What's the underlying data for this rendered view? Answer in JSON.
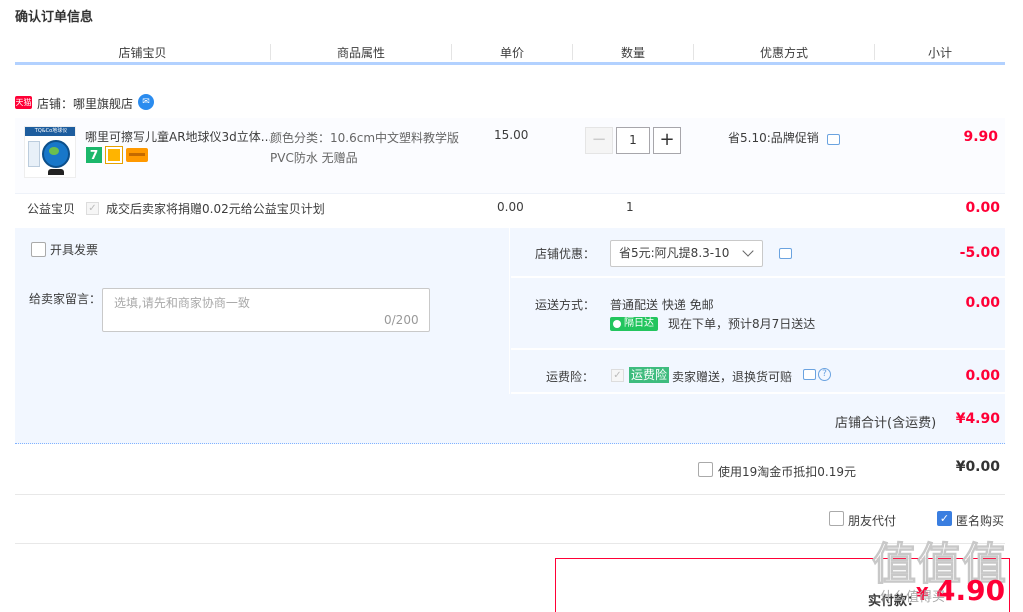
{
  "page_title": "确认订单信息",
  "headers": [
    "店铺宝贝",
    "商品属性",
    "单价",
    "数量",
    "优惠方式",
    "小计"
  ],
  "shop": {
    "logo": "天猫",
    "name": "店铺：哪里旗舰店",
    "ww_icon": "chat-bubble-icon"
  },
  "item": {
    "thumb_band": "TQ&Co地球仪",
    "title": "哪里可擦写儿童AR地球仪3d立体...",
    "attr": "颜色分类：10.6cm中文塑料教学版 PVC防水 无赠品",
    "unit_price": "15.00",
    "qty_minus": "−",
    "qty": "1",
    "qty_plus": "+",
    "promo": "省5.10:品牌促销",
    "subtotal": "9.90",
    "badge_7": "7"
  },
  "charity": {
    "label": "公益宝贝",
    "check": "✓",
    "text": "成交后卖家将捐赠0.02元给公益宝贝计划",
    "price": "0.00",
    "qty": "1",
    "subtotal": "0.00"
  },
  "invoice": {
    "label": "开具发票"
  },
  "message": {
    "label": "给卖家留言：",
    "placeholder": "选填,请先和商家协商一致",
    "count": "0/200"
  },
  "shop_discount": {
    "label": "店铺优惠：",
    "selected": "省5元:阿凡提8.3-10",
    "amount": "-5.00"
  },
  "delivery": {
    "label": "运送方式：",
    "method": "普通配送 快递 免邮",
    "tag": "隔日达",
    "eta": "现在下单，预计8月7日送达",
    "amount": "0.00"
  },
  "insurance": {
    "label": "运费险：",
    "check": "✓",
    "tag": "运费险",
    "text": "卖家赠送，退换货可赔",
    "help": "?",
    "amount": "0.00"
  },
  "shop_total": {
    "label": "店铺合计(含运费)",
    "value": "¥4.90"
  },
  "coins": {
    "text": "使用19淘金币抵扣0.19元",
    "value": "¥0.00"
  },
  "options": {
    "friend_pay": "朋友代付",
    "anonymous": "匿名购买",
    "anonymous_check": "✓"
  },
  "pay": {
    "label": "实付款：",
    "yen": "¥",
    "amount": "4.90"
  },
  "watermark": {
    "text": "值值值",
    "url": "什么值得买"
  },
  "colors": {
    "accent_red": "#ff0036",
    "panel_bg": "#f2f7ff",
    "header_line": "#b2d1ff",
    "checked_blue": "#3a7ee0"
  }
}
